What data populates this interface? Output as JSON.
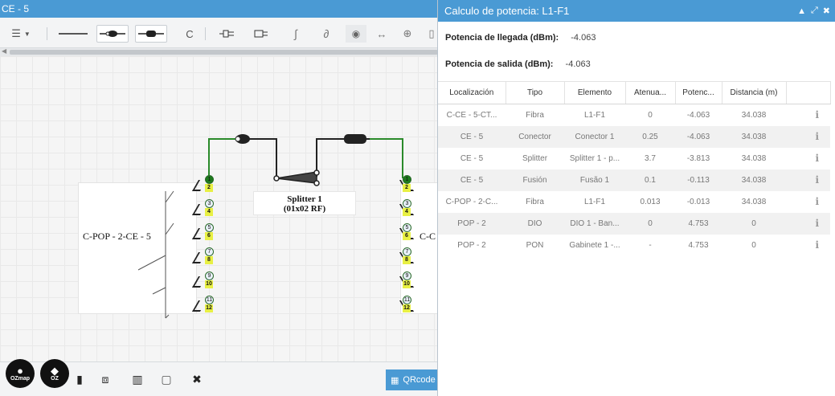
{
  "editor": {
    "title": "CE - 5",
    "toolbar": {
      "list_icon": "list-icon",
      "tools": [
        "line-tool",
        "connector-tool",
        "fusion-tool",
        "refresh-icon",
        "splitter-tool",
        "dio-tool",
        "link-tool",
        "unlink-tool",
        "view-tool",
        "expand-horizontal-tool",
        "crosshair-tool"
      ]
    },
    "diagram": {
      "left_box_label": "C-POP - 2-CE - 5",
      "right_box_label": "C-C",
      "splitter_label_line1": "Splitter 1",
      "splitter_label_line2": "(01x02 RF)",
      "left_ports": [
        {
          "top": "1",
          "bottom": "2"
        },
        {
          "top": "3",
          "bottom": "4"
        },
        {
          "top": "5",
          "bottom": "6"
        },
        {
          "top": "7",
          "bottom": "8"
        },
        {
          "top": "9",
          "bottom": "10"
        },
        {
          "top": "11",
          "bottom": "12"
        }
      ],
      "right_ports": [
        {
          "top": "1",
          "bottom": "2"
        },
        {
          "top": "3",
          "bottom": "4"
        },
        {
          "top": "5",
          "bottom": "6"
        },
        {
          "top": "7",
          "bottom": "8"
        },
        {
          "top": "9",
          "bottom": "10"
        },
        {
          "top": "11",
          "bottom": "12"
        }
      ],
      "colors": {
        "active_fiber": "#2a8a2a",
        "port_fill": "#e8f044",
        "active_port": "#1d7a1d"
      }
    },
    "bottom": {
      "logo1_text": "OZmap",
      "logo2_text": "OZ",
      "qr_label": "QRcode"
    }
  },
  "panel": {
    "title": "Calculo de potencia: L1-F1",
    "arrival_label": "Potencia de llegada (dBm):",
    "arrival_value": "-4.063",
    "output_label": "Potencia de salida (dBm):",
    "output_value": "-4.063",
    "columns": [
      "Localización",
      "Tipo",
      "Elemento",
      "Atenua...",
      "Potenc...",
      "Distancia (m)",
      ""
    ],
    "rows": [
      {
        "loc": "C-CE - 5-CT...",
        "tipo": "Fibra",
        "elem": "L1-F1",
        "aten": "0",
        "pot": "-4.063",
        "dist": "34.038"
      },
      {
        "loc": "CE - 5",
        "tipo": "Conector",
        "elem": "Conector 1",
        "aten": "0.25",
        "pot": "-4.063",
        "dist": "34.038"
      },
      {
        "loc": "CE - 5",
        "tipo": "Splitter",
        "elem": "Splitter 1 - p...",
        "aten": "3.7",
        "pot": "-3.813",
        "dist": "34.038"
      },
      {
        "loc": "CE - 5",
        "tipo": "Fusión",
        "elem": "Fusão 1",
        "aten": "0.1",
        "pot": "-0.113",
        "dist": "34.038"
      },
      {
        "loc": "C-POP - 2-C...",
        "tipo": "Fibra",
        "elem": "L1-F1",
        "aten": "0.013",
        "pot": "-0.013",
        "dist": "34.038"
      },
      {
        "loc": "POP - 2",
        "tipo": "DIO",
        "elem": "DIO 1 - Ban...",
        "aten": "0",
        "pot": "4.753",
        "dist": "0"
      },
      {
        "loc": "POP - 2",
        "tipo": "PON",
        "elem": "Gabinete 1 -...",
        "aten": "-",
        "pot": "4.753",
        "dist": "0"
      }
    ],
    "row_icon": "info-icon",
    "accent": "#4a9ad4"
  }
}
